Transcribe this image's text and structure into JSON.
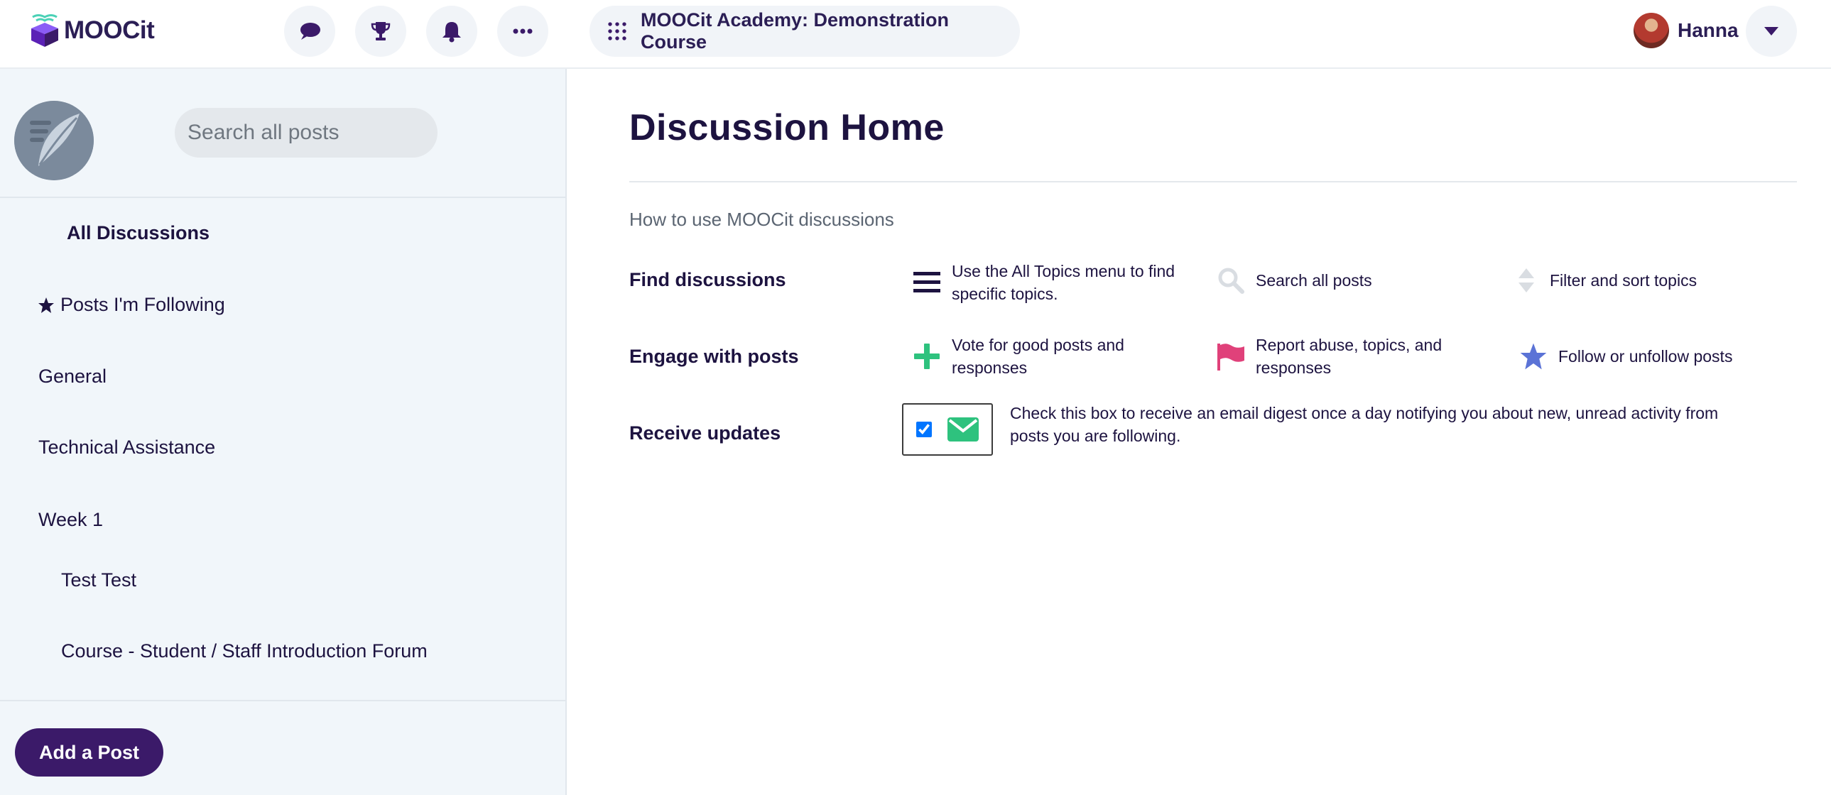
{
  "header": {
    "logo_text": "MOOCit",
    "course_title": "MOOCit Academy: Demonstration Course",
    "user_name": "Hanna",
    "icons": [
      "chat-bubble-icon",
      "trophy-icon",
      "bell-icon",
      "more-icon",
      "grid-icon",
      "chevron-down-icon"
    ]
  },
  "sidebar": {
    "search_placeholder": "Search all posts",
    "items": [
      {
        "label": "All Discussions"
      },
      {
        "label": "Posts I'm Following"
      },
      {
        "label": "General"
      },
      {
        "label": "Technical Assistance"
      },
      {
        "label": "Week 1"
      },
      {
        "label": "Test Test"
      },
      {
        "label": "Course - Student / Staff Introduction Forum"
      }
    ],
    "add_post_label": "Add a Post"
  },
  "main": {
    "title": "Discussion Home",
    "subtitle": "How to use MOOCit discussions",
    "rows": [
      {
        "label": "Find discussions",
        "features": [
          {
            "icon": "menu-icon",
            "text": "Use the All Topics menu to find specific topics."
          },
          {
            "icon": "search-icon",
            "text": "Search all posts"
          },
          {
            "icon": "sort-icon",
            "text": "Filter and sort topics"
          }
        ]
      },
      {
        "label": "Engage with posts",
        "features": [
          {
            "icon": "plus-icon",
            "text": "Vote for good posts and responses"
          },
          {
            "icon": "flag-icon",
            "text": "Report abuse, topics, and responses"
          },
          {
            "icon": "star-icon",
            "text": "Follow or unfollow posts"
          }
        ]
      },
      {
        "label": "Receive updates",
        "digest_checked": true,
        "digest_text": "Check this box to receive an email digest once a day notifying you about new, unread activity from posts you are following."
      }
    ]
  },
  "colors": {
    "brand_purple": "#3b1a69",
    "text_dark": "#1d1340",
    "sidebar_bg": "#f1f6fa",
    "green": "#2ec27e",
    "pink": "#e0417a",
    "blue": "#5b73d6"
  }
}
